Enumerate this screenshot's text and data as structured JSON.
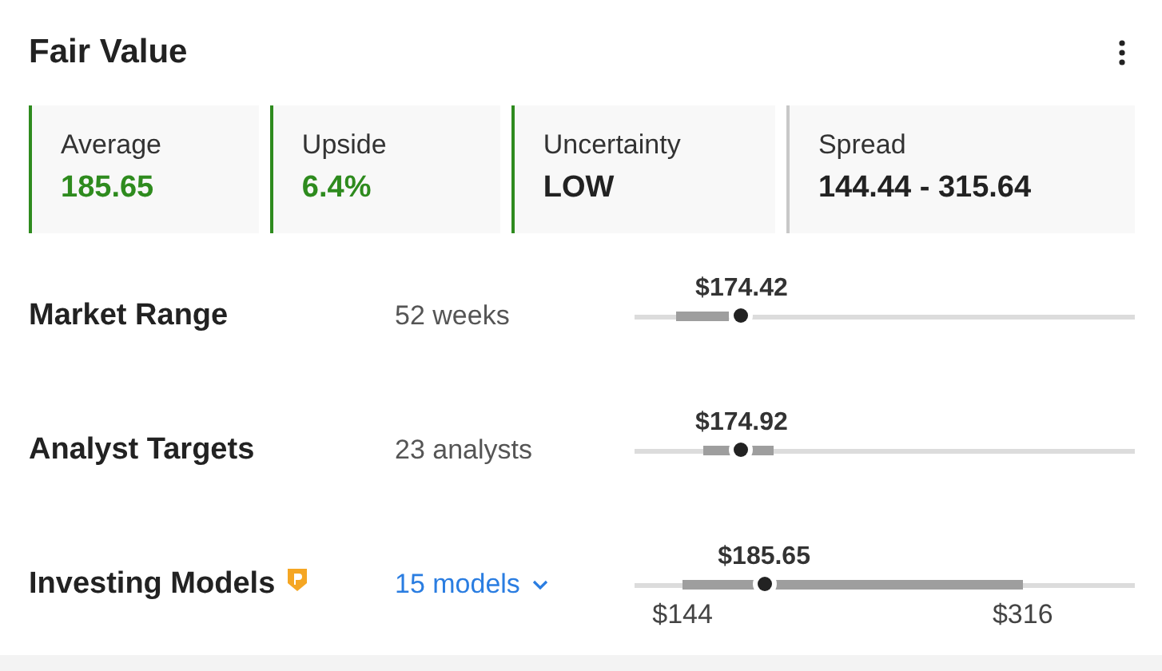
{
  "title": "Fair Value",
  "cards": [
    {
      "label": "Average",
      "value": "185.65",
      "highlighted": true,
      "color": "#2e8b1e"
    },
    {
      "label": "Upside",
      "value": "6.4%",
      "highlighted": true,
      "color": "#2e8b1e"
    },
    {
      "label": "Uncertainty",
      "value": "LOW",
      "highlighted": false,
      "color": "#2e8b1e"
    },
    {
      "label": "Spread",
      "value": "144.44 - 315.64",
      "highlighted": false,
      "color": "#c8c8c8"
    }
  ],
  "rows": [
    {
      "label": "Market Range",
      "kind": "text",
      "detail": "52 weeks",
      "price": "$174.42",
      "marker": {
        "level": 0.214
      }
    },
    {
      "label": "Analyst Targets",
      "kind": "text",
      "detail": "23 analysts",
      "price": "$174.92",
      "marker": {
        "level": 0.214
      }
    },
    {
      "label": "Investing Models",
      "kind": "link",
      "badge": true,
      "detail": "15 models",
      "price": "$185.65",
      "marker": {
        "level": 0.259
      },
      "low_label": "$144",
      "high_label": "$316"
    }
  ]
}
